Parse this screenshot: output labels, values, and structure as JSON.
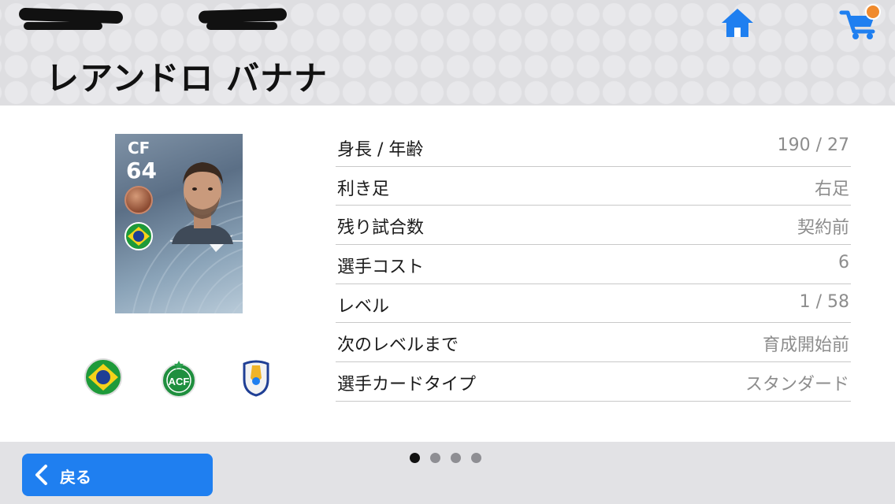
{
  "header": {
    "player_name": "レアンドロ バナナ"
  },
  "card": {
    "position": "CF",
    "overall": "64",
    "nationality_icon": "brazil-flag-icon",
    "badge_icon": "bronze-badge-icon"
  },
  "affiliations": [
    {
      "icon": "brazil-flag-icon"
    },
    {
      "icon": "club-crest-icon"
    },
    {
      "icon": "league-logo-icon"
    }
  ],
  "stats": [
    {
      "label": "身長 / 年齢",
      "value": "190 / 27"
    },
    {
      "label": "利き足",
      "value": "右足"
    },
    {
      "label": "残り試合数",
      "value": "契約前"
    },
    {
      "label": "選手コスト",
      "value": "6"
    },
    {
      "label": "レベル",
      "value": "1 / 58"
    },
    {
      "label": "次のレベルまで",
      "value": "育成開始前"
    },
    {
      "label": "選手カードタイプ",
      "value": "スタンダード"
    }
  ],
  "footer": {
    "back_label": "戻る"
  },
  "pager": {
    "total": 4,
    "active_index": 0
  },
  "colors": {
    "accent": "#1f7ff0",
    "cart_notification": "#f08a2c",
    "header_bg": "#dedee1"
  }
}
